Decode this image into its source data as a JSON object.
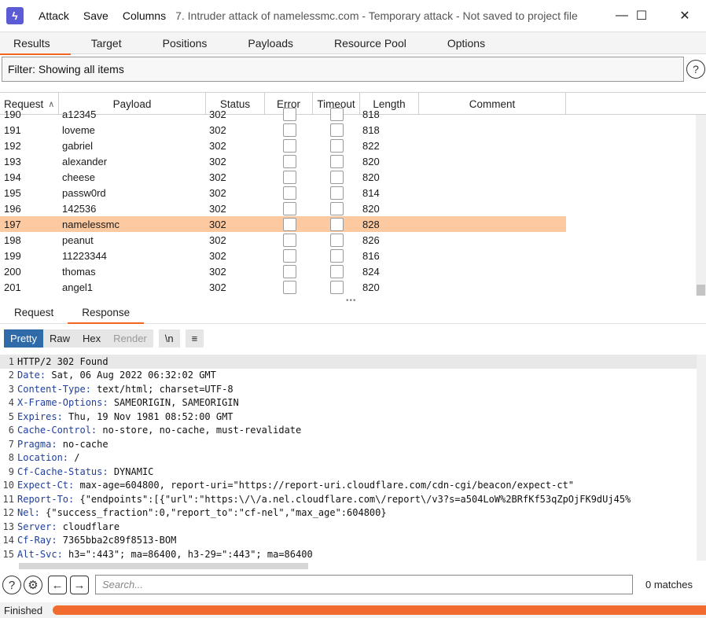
{
  "titlebar": {
    "menu": [
      "Attack",
      "Save",
      "Columns"
    ],
    "title": "7. Intruder attack of namelessmc.com - Temporary attack - Not saved to project file",
    "minimize": "—",
    "maximize": "☐",
    "close": "✕"
  },
  "main_tabs": [
    "Results",
    "Target",
    "Positions",
    "Payloads",
    "Resource Pool",
    "Options"
  ],
  "filter": {
    "text": "Filter: Showing all items"
  },
  "table": {
    "columns": [
      "Request",
      "Payload",
      "Status",
      "Error",
      "Timeout",
      "Length",
      "Comment"
    ],
    "partial_row": {
      "request": "190",
      "payload": "a12345",
      "status": "302",
      "length": "818"
    },
    "rows": [
      {
        "request": "191",
        "payload": "loveme",
        "status": "302",
        "length": "818"
      },
      {
        "request": "192",
        "payload": "gabriel",
        "status": "302",
        "length": "822"
      },
      {
        "request": "193",
        "payload": "alexander",
        "status": "302",
        "length": "820"
      },
      {
        "request": "194",
        "payload": "cheese",
        "status": "302",
        "length": "820"
      },
      {
        "request": "195",
        "payload": "passw0rd",
        "status": "302",
        "length": "814"
      },
      {
        "request": "196",
        "payload": "142536",
        "status": "302",
        "length": "820"
      },
      {
        "request": "197",
        "payload": "namelessmc",
        "status": "302",
        "length": "828",
        "selected": true
      },
      {
        "request": "198",
        "payload": "peanut",
        "status": "302",
        "length": "826"
      },
      {
        "request": "199",
        "payload": "11223344",
        "status": "302",
        "length": "816"
      },
      {
        "request": "200",
        "payload": "thomas",
        "status": "302",
        "length": "824"
      },
      {
        "request": "201",
        "payload": "angel1",
        "status": "302",
        "length": "820"
      }
    ],
    "selected_color": "#fcc9a1"
  },
  "sub_tabs": [
    "Request",
    "Response"
  ],
  "view_buttons": [
    "Pretty",
    "Raw",
    "Hex",
    "Render",
    "\\n",
    "≡"
  ],
  "response_lines": [
    {
      "n": "1",
      "key": "HTTP/2 302 Found",
      "val": ""
    },
    {
      "n": "2",
      "key": "Date:",
      "val": " Sat, 06 Aug 2022 06:32:02 GMT"
    },
    {
      "n": "3",
      "key": "Content-Type:",
      "val": " text/html; charset=UTF-8"
    },
    {
      "n": "4",
      "key": "X-Frame-Options:",
      "val": " SAMEORIGIN, SAMEORIGIN"
    },
    {
      "n": "5",
      "key": "Expires:",
      "val": " Thu, 19 Nov 1981 08:52:00 GMT"
    },
    {
      "n": "6",
      "key": "Cache-Control:",
      "val": " no-store, no-cache, must-revalidate"
    },
    {
      "n": "7",
      "key": "Pragma:",
      "val": " no-cache"
    },
    {
      "n": "8",
      "key": "Location:",
      "val": " /"
    },
    {
      "n": "9",
      "key": "Cf-Cache-Status:",
      "val": " DYNAMIC"
    },
    {
      "n": "10",
      "key": "Expect-Ct:",
      "val": " max-age=604800, report-uri=\"https://report-uri.cloudflare.com/cdn-cgi/beacon/expect-ct\""
    },
    {
      "n": "11",
      "key": "Report-To:",
      "val": " {\"endpoints\":[{\"url\":\"https:\\/\\/a.nel.cloudflare.com\\/report\\/v3?s=a504LoW%2BRfKf53qZpOjFK9dUj45%"
    },
    {
      "n": "12",
      "key": "Nel:",
      "val": " {\"success_fraction\":0,\"report_to\":\"cf-nel\",\"max_age\":604800}"
    },
    {
      "n": "13",
      "key": "Server:",
      "val": " cloudflare"
    },
    {
      "n": "14",
      "key": "Cf-Ray:",
      "val": " 7365bba2c89f8513-BOM"
    },
    {
      "n": "15",
      "key": "Alt-Svc:",
      "val": " h3=\":443\"; ma=86400, h3-29=\":443\"; ma=86400"
    }
  ],
  "search": {
    "placeholder": "Search...",
    "matches": "0 matches"
  },
  "status": {
    "text": "Finished",
    "progress": 1.0
  },
  "colors": {
    "accent": "#f26522",
    "header_key": "#1f3f9c",
    "active_view": "#2f6aa9"
  }
}
